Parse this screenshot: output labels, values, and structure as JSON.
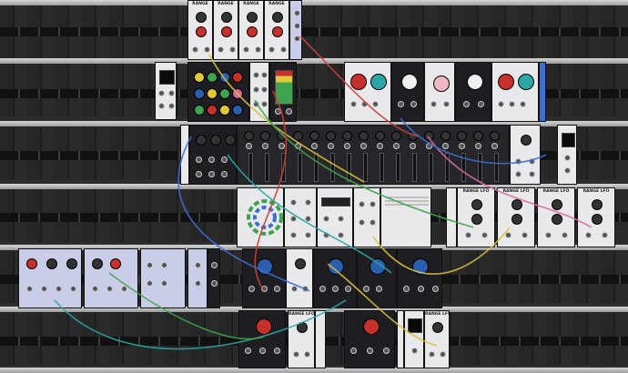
{
  "modules": {
    "range": "RANGE",
    "range_lfo": "RANGE LFO"
  },
  "colors": {
    "cable_yellow": "#d8c23a",
    "cable_green": "#3fa34d",
    "cable_teal": "#2aa6a6",
    "cable_red": "#c8403a",
    "cable_blue": "#3b6fd1",
    "cable_pink": "#d86aa0",
    "knob_red": "#c8302c",
    "knob_blue": "#2a5fb0",
    "accent_pink": "#f2b7c6"
  },
  "icons": {
    "cable": "patch-cable-icon",
    "knob": "knob-icon",
    "jack": "jack-icon"
  }
}
